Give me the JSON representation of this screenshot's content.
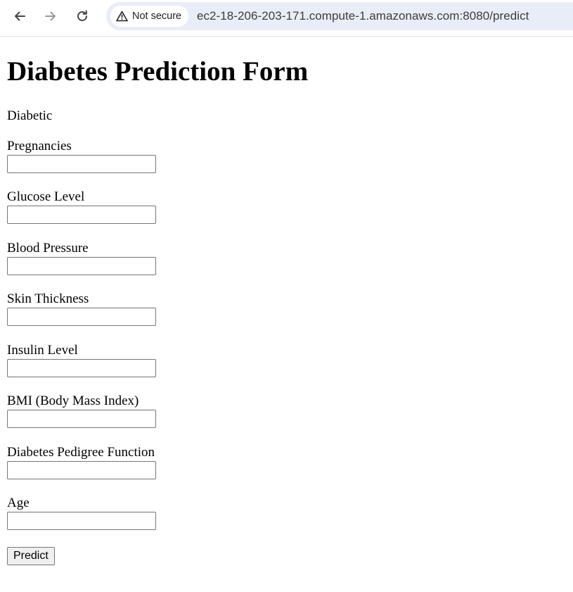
{
  "browser": {
    "security_label": "Not secure",
    "url": "ec2-18-206-203-171.compute-1.amazonaws.com:8080/predict"
  },
  "page": {
    "title": "Diabetes Prediction Form",
    "result": "Diabetic",
    "fields": [
      {
        "label": "Pregnancies",
        "value": ""
      },
      {
        "label": "Glucose Level",
        "value": ""
      },
      {
        "label": "Blood Pressure",
        "value": ""
      },
      {
        "label": "Skin Thickness",
        "value": ""
      },
      {
        "label": "Insulin Level",
        "value": ""
      },
      {
        "label": "BMI (Body Mass Index)",
        "value": ""
      },
      {
        "label": "Diabetes Pedigree Function",
        "value": ""
      },
      {
        "label": "Age",
        "value": ""
      }
    ],
    "submit_label": "Predict"
  }
}
